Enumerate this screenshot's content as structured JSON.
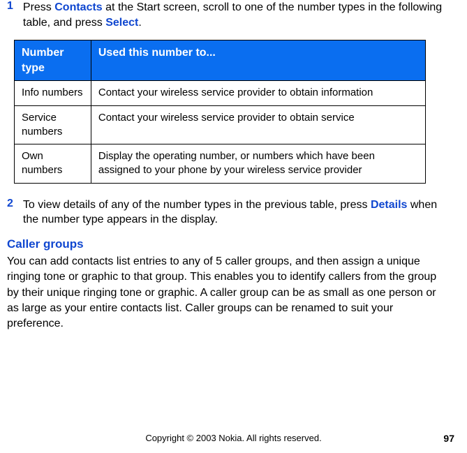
{
  "step1": {
    "num": "1",
    "prefix": "Press ",
    "link1": "Contacts",
    "mid": " at the Start screen, scroll to one of the number types in the following table, and press ",
    "link2": "Select",
    "suffix": "."
  },
  "table": {
    "header": {
      "col1": "Number type",
      "col2": "Used this number to..."
    },
    "rows": [
      {
        "col1": "Info numbers",
        "col2": "Contact your wireless service provider to obtain information"
      },
      {
        "col1": "Service numbers",
        "col2": "Contact your wireless service provider to obtain service"
      },
      {
        "col1": "Own numbers",
        "col2": "Display the operating number, or numbers which have been assigned to your phone by your wireless service provider"
      }
    ]
  },
  "step2": {
    "num": "2",
    "prefix": "To view details of any of the number types in the previous table, press ",
    "link1": "Details",
    "suffix": " when the number type appears in the display."
  },
  "section": {
    "heading": "Caller groups",
    "body": "You can add contacts list entries to any of 5 caller groups, and then assign a unique ringing tone or graphic to that group. This enables you to identify callers from the group by their unique ringing tone or graphic. A caller group can be as small as one person or as large as your entire contacts list. Caller groups can be renamed to suit your preference."
  },
  "footer": {
    "copyright": "Copyright © 2003 Nokia. All rights reserved.",
    "page": "97"
  }
}
